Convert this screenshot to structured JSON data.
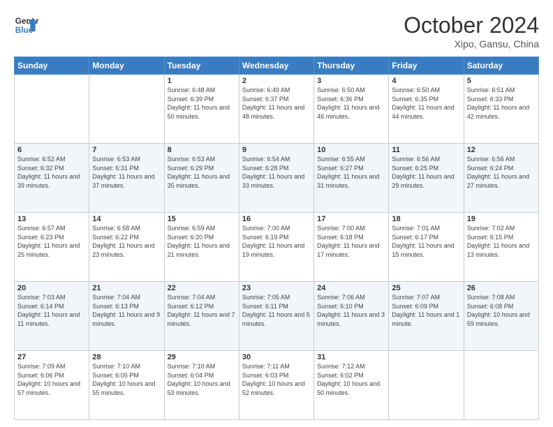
{
  "logo": {
    "line1": "General",
    "line2": "Blue"
  },
  "title": "October 2024",
  "subtitle": "Xipo, Gansu, China",
  "weekdays": [
    "Sunday",
    "Monday",
    "Tuesday",
    "Wednesday",
    "Thursday",
    "Friday",
    "Saturday"
  ],
  "weeks": [
    [
      {
        "day": "",
        "sunrise": "",
        "sunset": "",
        "daylight": ""
      },
      {
        "day": "",
        "sunrise": "",
        "sunset": "",
        "daylight": ""
      },
      {
        "day": "1",
        "sunrise": "Sunrise: 6:48 AM",
        "sunset": "Sunset: 6:39 PM",
        "daylight": "Daylight: 11 hours and 50 minutes."
      },
      {
        "day": "2",
        "sunrise": "Sunrise: 6:49 AM",
        "sunset": "Sunset: 6:37 PM",
        "daylight": "Daylight: 11 hours and 48 minutes."
      },
      {
        "day": "3",
        "sunrise": "Sunrise: 6:50 AM",
        "sunset": "Sunset: 6:36 PM",
        "daylight": "Daylight: 11 hours and 46 minutes."
      },
      {
        "day": "4",
        "sunrise": "Sunrise: 6:50 AM",
        "sunset": "Sunset: 6:35 PM",
        "daylight": "Daylight: 11 hours and 44 minutes."
      },
      {
        "day": "5",
        "sunrise": "Sunrise: 6:51 AM",
        "sunset": "Sunset: 6:33 PM",
        "daylight": "Daylight: 11 hours and 42 minutes."
      }
    ],
    [
      {
        "day": "6",
        "sunrise": "Sunrise: 6:52 AM",
        "sunset": "Sunset: 6:32 PM",
        "daylight": "Daylight: 11 hours and 39 minutes."
      },
      {
        "day": "7",
        "sunrise": "Sunrise: 6:53 AM",
        "sunset": "Sunset: 6:31 PM",
        "daylight": "Daylight: 11 hours and 37 minutes."
      },
      {
        "day": "8",
        "sunrise": "Sunrise: 6:53 AM",
        "sunset": "Sunset: 6:29 PM",
        "daylight": "Daylight: 11 hours and 35 minutes."
      },
      {
        "day": "9",
        "sunrise": "Sunrise: 6:54 AM",
        "sunset": "Sunset: 6:28 PM",
        "daylight": "Daylight: 11 hours and 33 minutes."
      },
      {
        "day": "10",
        "sunrise": "Sunrise: 6:55 AM",
        "sunset": "Sunset: 6:27 PM",
        "daylight": "Daylight: 11 hours and 31 minutes."
      },
      {
        "day": "11",
        "sunrise": "Sunrise: 6:56 AM",
        "sunset": "Sunset: 6:25 PM",
        "daylight": "Daylight: 11 hours and 29 minutes."
      },
      {
        "day": "12",
        "sunrise": "Sunrise: 6:56 AM",
        "sunset": "Sunset: 6:24 PM",
        "daylight": "Daylight: 11 hours and 27 minutes."
      }
    ],
    [
      {
        "day": "13",
        "sunrise": "Sunrise: 6:57 AM",
        "sunset": "Sunset: 6:23 PM",
        "daylight": "Daylight: 11 hours and 25 minutes."
      },
      {
        "day": "14",
        "sunrise": "Sunrise: 6:58 AM",
        "sunset": "Sunset: 6:22 PM",
        "daylight": "Daylight: 11 hours and 23 minutes."
      },
      {
        "day": "15",
        "sunrise": "Sunrise: 6:59 AM",
        "sunset": "Sunset: 6:20 PM",
        "daylight": "Daylight: 11 hours and 21 minutes."
      },
      {
        "day": "16",
        "sunrise": "Sunrise: 7:00 AM",
        "sunset": "Sunset: 6:19 PM",
        "daylight": "Daylight: 11 hours and 19 minutes."
      },
      {
        "day": "17",
        "sunrise": "Sunrise: 7:00 AM",
        "sunset": "Sunset: 6:18 PM",
        "daylight": "Daylight: 11 hours and 17 minutes."
      },
      {
        "day": "18",
        "sunrise": "Sunrise: 7:01 AM",
        "sunset": "Sunset: 6:17 PM",
        "daylight": "Daylight: 11 hours and 15 minutes."
      },
      {
        "day": "19",
        "sunrise": "Sunrise: 7:02 AM",
        "sunset": "Sunset: 6:15 PM",
        "daylight": "Daylight: 11 hours and 13 minutes."
      }
    ],
    [
      {
        "day": "20",
        "sunrise": "Sunrise: 7:03 AM",
        "sunset": "Sunset: 6:14 PM",
        "daylight": "Daylight: 11 hours and 11 minutes."
      },
      {
        "day": "21",
        "sunrise": "Sunrise: 7:04 AM",
        "sunset": "Sunset: 6:13 PM",
        "daylight": "Daylight: 11 hours and 9 minutes."
      },
      {
        "day": "22",
        "sunrise": "Sunrise: 7:04 AM",
        "sunset": "Sunset: 6:12 PM",
        "daylight": "Daylight: 11 hours and 7 minutes."
      },
      {
        "day": "23",
        "sunrise": "Sunrise: 7:05 AM",
        "sunset": "Sunset: 6:11 PM",
        "daylight": "Daylight: 11 hours and 5 minutes."
      },
      {
        "day": "24",
        "sunrise": "Sunrise: 7:06 AM",
        "sunset": "Sunset: 6:10 PM",
        "daylight": "Daylight: 11 hours and 3 minutes."
      },
      {
        "day": "25",
        "sunrise": "Sunrise: 7:07 AM",
        "sunset": "Sunset: 6:09 PM",
        "daylight": "Daylight: 11 hours and 1 minute."
      },
      {
        "day": "26",
        "sunrise": "Sunrise: 7:08 AM",
        "sunset": "Sunset: 6:08 PM",
        "daylight": "Daylight: 10 hours and 59 minutes."
      }
    ],
    [
      {
        "day": "27",
        "sunrise": "Sunrise: 7:09 AM",
        "sunset": "Sunset: 6:06 PM",
        "daylight": "Daylight: 10 hours and 57 minutes."
      },
      {
        "day": "28",
        "sunrise": "Sunrise: 7:10 AM",
        "sunset": "Sunset: 6:05 PM",
        "daylight": "Daylight: 10 hours and 55 minutes."
      },
      {
        "day": "29",
        "sunrise": "Sunrise: 7:10 AM",
        "sunset": "Sunset: 6:04 PM",
        "daylight": "Daylight: 10 hours and 53 minutes."
      },
      {
        "day": "30",
        "sunrise": "Sunrise: 7:11 AM",
        "sunset": "Sunset: 6:03 PM",
        "daylight": "Daylight: 10 hours and 52 minutes."
      },
      {
        "day": "31",
        "sunrise": "Sunrise: 7:12 AM",
        "sunset": "Sunset: 6:02 PM",
        "daylight": "Daylight: 10 hours and 50 minutes."
      },
      {
        "day": "",
        "sunrise": "",
        "sunset": "",
        "daylight": ""
      },
      {
        "day": "",
        "sunrise": "",
        "sunset": "",
        "daylight": ""
      }
    ]
  ]
}
